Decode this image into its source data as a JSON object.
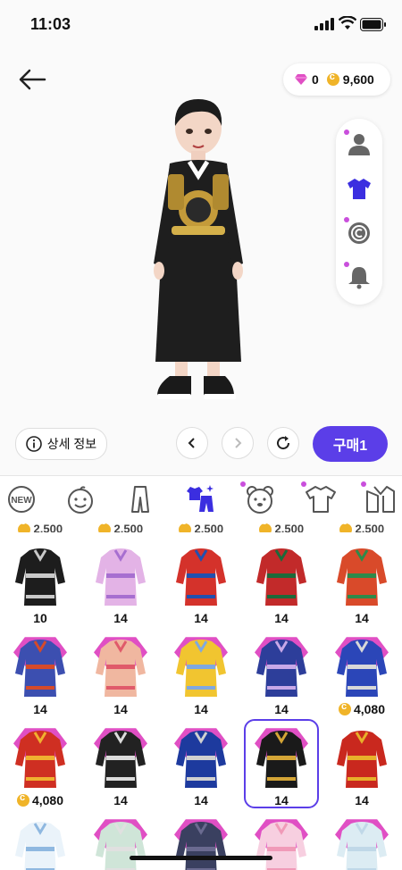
{
  "status_bar": {
    "time": "11:03"
  },
  "wallet": {
    "gems": "0",
    "coins": "9,600"
  },
  "details_label": "상세 정보",
  "buy_label": "구매1",
  "tabs": [
    {
      "icon": "new-icon",
      "label": "NEW"
    },
    {
      "icon": "face-icon"
    },
    {
      "icon": "outfit-icon"
    },
    {
      "icon": "clothing-set-icon",
      "active": true
    },
    {
      "icon": "bear-icon",
      "dot": true
    },
    {
      "icon": "tshirt-icon",
      "dot": true
    },
    {
      "icon": "jacket-icon",
      "dot": true
    }
  ],
  "partial_prices": [
    "2,500",
    "2,500",
    "2,500",
    "2,500",
    "2,500"
  ],
  "items": [
    {
      "price": "10",
      "currency": "gem",
      "color": "#1d1d1d",
      "trim": "#c9c9c9"
    },
    {
      "price": "14",
      "currency": "gem",
      "color": "#e3b3e6",
      "trim": "#a76fd0"
    },
    {
      "price": "14",
      "currency": "gem",
      "color": "#d4322b",
      "trim": "#2050b0"
    },
    {
      "price": "14",
      "currency": "gem",
      "color": "#c22a2a",
      "trim": "#1d6a3a"
    },
    {
      "price": "14",
      "currency": "gem",
      "color": "#d94a2a",
      "trim": "#2e8a4a"
    },
    {
      "price": "14",
      "currency": "gem",
      "color": "#3c4fb0",
      "trim": "#d54a2a"
    },
    {
      "price": "14",
      "currency": "gem",
      "color": "#f0b7a0",
      "trim": "#e05a6a"
    },
    {
      "price": "14",
      "currency": "gem",
      "color": "#f1c530",
      "trim": "#7fa8e0"
    },
    {
      "price": "14",
      "currency": "gem",
      "color": "#2d3e9a",
      "trim": "#c8a8e8"
    },
    {
      "price": "4,080",
      "currency": "coin",
      "color": "#2b46b8",
      "trim": "#d8d8d8"
    },
    {
      "price": "4,080",
      "currency": "coin",
      "color": "#cf2f22",
      "trim": "#f0b030"
    },
    {
      "price": "14",
      "currency": "gem",
      "color": "#222222",
      "trim": "#dcdcdc"
    },
    {
      "price": "14",
      "currency": "gem",
      "color": "#1d3a9e",
      "trim": "#d0d0d0"
    },
    {
      "price": "14",
      "currency": "gem",
      "color": "#1a1a1a",
      "trim": "#d4a536",
      "selected": true
    },
    {
      "price": "14",
      "currency": "gem",
      "color": "#c9281e",
      "trim": "#e8b02a"
    }
  ],
  "partial_items": [
    {
      "color": "#eaf3fa",
      "trim": "#8fb8e0"
    },
    {
      "color": "#cfe5d8",
      "trim": "#e0e0e0"
    },
    {
      "color": "#3a4060",
      "trim": "#6a6a90"
    },
    {
      "color": "#f7cfe0",
      "trim": "#f09ab8"
    },
    {
      "color": "#dcecf3",
      "trim": "#c0d8e8"
    }
  ]
}
